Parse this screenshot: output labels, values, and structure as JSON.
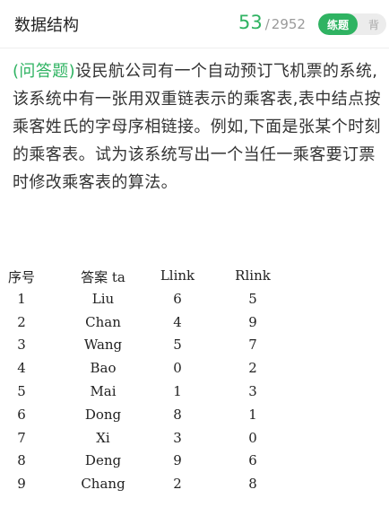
{
  "header": {
    "title": "数据结构",
    "current_index": "53",
    "separator": "/",
    "total_count": "2952",
    "mode_active": "练题",
    "mode_inactive": "背"
  },
  "question": {
    "tag": "(问答题)",
    "text": "设民航公司有一个自动预订飞机票的系统,该系统中有一张用双重链表示的乘客表,表中结点按乘客姓氏的字母序相链接。例如,下面是张某个时刻的乘客表。试为该系统写出一个当任一乘客要订票时修改乘客表的算法。"
  },
  "table": {
    "headers": [
      "序号",
      "答案 ta",
      "Llink",
      "Rlink"
    ],
    "rows": [
      [
        "1",
        "Liu",
        "6",
        "5"
      ],
      [
        "2",
        "Chan",
        "4",
        "9"
      ],
      [
        "3",
        "Wang",
        "5",
        "7"
      ],
      [
        "4",
        "Bao",
        "0",
        "2"
      ],
      [
        "5",
        "Mai",
        "1",
        "3"
      ],
      [
        "6",
        "Dong",
        "8",
        "1"
      ],
      [
        "7",
        "Xi",
        "3",
        "0"
      ],
      [
        "8",
        "Deng",
        "9",
        "6"
      ],
      [
        "9",
        "Chang",
        "2",
        "8"
      ]
    ]
  },
  "colors": {
    "accent": "#2fb362",
    "text": "#333333",
    "muted": "#9a9a9a"
  }
}
